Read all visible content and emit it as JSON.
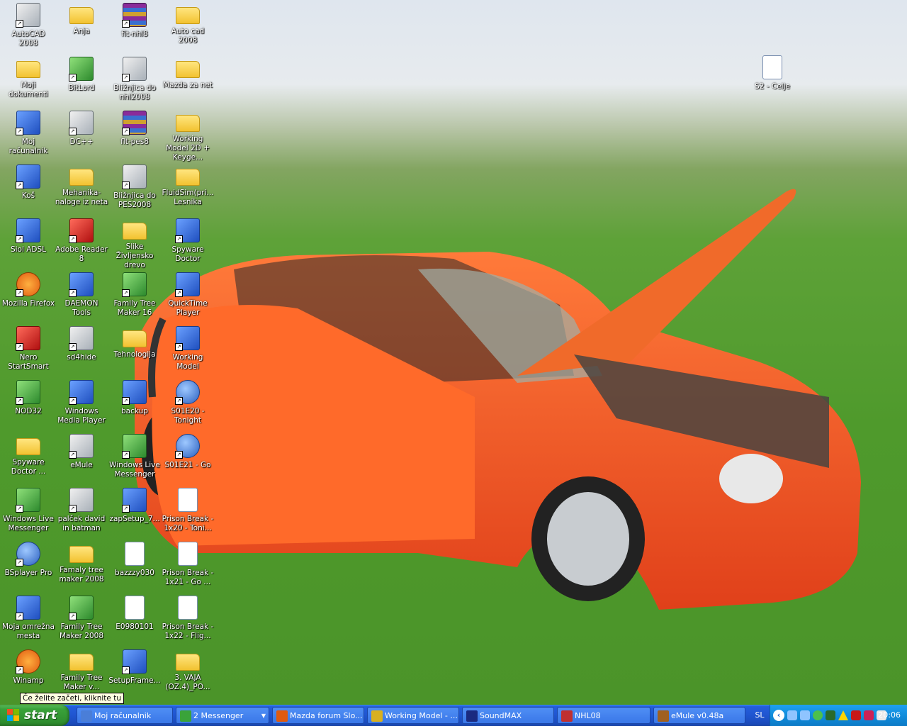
{
  "desktop": {
    "icons": [
      {
        "label": "AutoCAD 2008",
        "glyph": "gray"
      },
      {
        "label": "Anja",
        "glyph": "folder"
      },
      {
        "label": "flt-nhl8",
        "glyph": "rar"
      },
      {
        "label": "Auto cad 2008",
        "glyph": "folder"
      },
      {
        "label": "Moji dokumenti",
        "glyph": "folder"
      },
      {
        "label": "BitLord",
        "glyph": "green"
      },
      {
        "label": "Bližnjica do nhl2008",
        "glyph": "gray"
      },
      {
        "label": "Mazda za net",
        "glyph": "folder"
      },
      {
        "label": "Moj računalnik",
        "glyph": "app"
      },
      {
        "label": "DC++",
        "glyph": "gray"
      },
      {
        "label": "flt-pes8",
        "glyph": "rar"
      },
      {
        "label": "Working Model 2D + Keyge...",
        "glyph": "folder"
      },
      {
        "label": "Koš",
        "glyph": "app"
      },
      {
        "label": "Mehanika-naloge iz neta",
        "glyph": "folder"
      },
      {
        "label": "Bližnjica do PES2008",
        "glyph": "gray"
      },
      {
        "label": "FluidSim(pri... Lesnika",
        "glyph": "folder"
      },
      {
        "label": "Siol ADSL",
        "glyph": "app"
      },
      {
        "label": "Adobe Reader 8",
        "glyph": "red"
      },
      {
        "label": "Slike Življensko drevo",
        "glyph": "folder"
      },
      {
        "label": "Spyware Doctor",
        "glyph": "app"
      },
      {
        "label": "Mozilla Firefox",
        "glyph": "orange"
      },
      {
        "label": "DAEMON Tools",
        "glyph": "app"
      },
      {
        "label": "Family Tree Maker 16",
        "glyph": "green"
      },
      {
        "label": "QuickTime Player",
        "glyph": "app"
      },
      {
        "label": "Nero StartSmart",
        "glyph": "red"
      },
      {
        "label": "sd4hide",
        "glyph": "gray"
      },
      {
        "label": "Tehnologija",
        "glyph": "folder"
      },
      {
        "label": "Working Model",
        "glyph": "app"
      },
      {
        "label": "NOD32",
        "glyph": "green"
      },
      {
        "label": "Windows Media Player",
        "glyph": "app"
      },
      {
        "label": "backup",
        "glyph": "app"
      },
      {
        "label": "S01E20 - Tonight",
        "glyph": "bs"
      },
      {
        "label": "Spyware Doctor ...",
        "glyph": "folder"
      },
      {
        "label": "eMule",
        "glyph": "gray"
      },
      {
        "label": "Windows Live Messenger",
        "glyph": "green"
      },
      {
        "label": "S01E21 - Go",
        "glyph": "bs"
      },
      {
        "label": "Windows Live Messenger",
        "glyph": "green"
      },
      {
        "label": "palček david in batman",
        "glyph": "gray"
      },
      {
        "label": "zapSetup_7...",
        "glyph": "app"
      },
      {
        "label": "Prison Break - 1x20 - Toni...",
        "glyph": "doc"
      },
      {
        "label": "BSplayer Pro",
        "glyph": "bs"
      },
      {
        "label": "Famaly tree maker 2008",
        "glyph": "folder"
      },
      {
        "label": "bazzzy030",
        "glyph": "doc"
      },
      {
        "label": "Prison Break - 1x21 - Go ...",
        "glyph": "doc"
      },
      {
        "label": "Moja omrežna mesta",
        "glyph": "app"
      },
      {
        "label": "Family Tree Maker 2008",
        "glyph": "green"
      },
      {
        "label": "E0980101",
        "glyph": "doc"
      },
      {
        "label": "Prison Break - 1x22 - Flig...",
        "glyph": "doc"
      },
      {
        "label": "Winamp",
        "glyph": "orange"
      },
      {
        "label": "Family Tree Maker v...",
        "glyph": "folder"
      },
      {
        "label": "SetupFrame...",
        "glyph": "app"
      },
      {
        "label": "3. VAJA (OZ.4)_PO...",
        "glyph": "folder"
      },
      {
        "label": "S2 - Celje",
        "glyph": "doc"
      }
    ],
    "tooltip": "Če želite začeti, kliknite tu"
  },
  "taskbar": {
    "start_label": "start",
    "buttons": [
      {
        "label": "Moj računalnik",
        "color": "#4a7ed8"
      },
      {
        "label": "2 Messenger",
        "color": "#3aa33a"
      },
      {
        "label": "Mazda forum Slo...",
        "color": "#e05a10"
      },
      {
        "label": "Working Model - ...",
        "color": "#d8b020"
      },
      {
        "label": "SoundMAX",
        "color": "#1a2a80"
      },
      {
        "label": "NHL08",
        "color": "#c03030"
      },
      {
        "label": "eMule v0.48a",
        "color": "#a06020"
      }
    ],
    "lang": "SL",
    "clock": "20:06"
  },
  "colors": {
    "accent": "#245edb",
    "start": "#3aa23a",
    "tray": "#118ddc"
  }
}
